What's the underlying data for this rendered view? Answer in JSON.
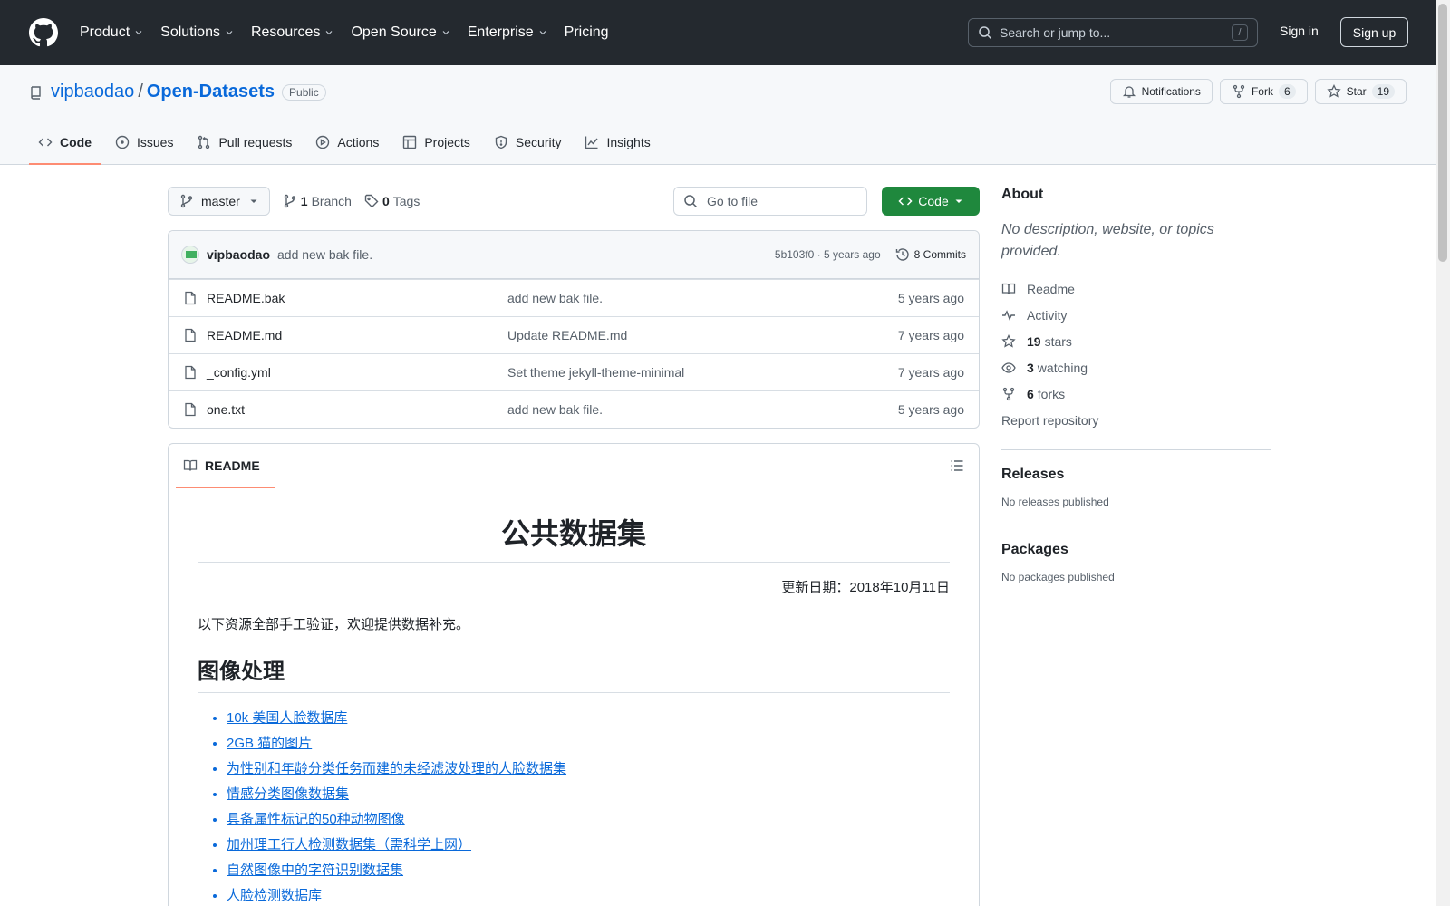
{
  "header": {
    "nav": [
      "Product",
      "Solutions",
      "Resources",
      "Open Source",
      "Enterprise",
      "Pricing"
    ],
    "search_placeholder": "Search or jump to...",
    "search_shortcut": "/",
    "sign_in": "Sign in",
    "sign_up": "Sign up"
  },
  "repo": {
    "owner": "vipbaodao",
    "separator": "/",
    "name": "Open-Datasets",
    "visibility": "Public",
    "notifications_label": "Notifications",
    "fork_label": "Fork",
    "fork_count": "6",
    "star_label": "Star",
    "star_count": "19",
    "tabs": [
      "Code",
      "Issues",
      "Pull requests",
      "Actions",
      "Projects",
      "Security",
      "Insights"
    ]
  },
  "toolbar": {
    "branch": "master",
    "branch_count": "1",
    "branch_label": "Branch",
    "tag_count": "0",
    "tag_label": "Tags",
    "go_to_file": "Go to file",
    "code_button": "Code"
  },
  "latest_commit": {
    "author": "vipbaodao",
    "message": "add new bak file.",
    "meta": "5b103f0 · 5 years ago",
    "commits": "8 Commits"
  },
  "files": [
    {
      "name": "README.bak",
      "message": "add new bak file.",
      "time": "5 years ago"
    },
    {
      "name": "README.md",
      "message": "Update README.md",
      "time": "7 years ago"
    },
    {
      "name": "_config.yml",
      "message": "Set theme jekyll-theme-minimal",
      "time": "7 years ago"
    },
    {
      "name": "one.txt",
      "message": "add new bak file.",
      "time": "5 years ago"
    }
  ],
  "readme": {
    "tab": "README",
    "title": "公共数据集",
    "date": "更新日期：2018年10月11日",
    "intro": "以下资源全部手工验证，欢迎提供数据补充。",
    "section": "图像处理",
    "links": [
      "10k 美国人脸数据库",
      "2GB 猫的图片",
      "为性别和年龄分类任务而建的未经滤波处理的人脸数据集",
      "情感分类图像数据集",
      "具备属性标记的50种动物图像",
      "加州理工行人检测数据集（需科学上网）",
      "自然图像中的字符识别数据集",
      "人脸检测数据库"
    ]
  },
  "sidebar": {
    "about_title": "About",
    "description": "No description, website, or topics provided.",
    "readme": "Readme",
    "activity": "Activity",
    "stars_count": "19",
    "stars_label": "stars",
    "watching_count": "3",
    "watching_label": "watching",
    "forks_count": "6",
    "forks_label": "forks",
    "report": "Report repository",
    "releases_title": "Releases",
    "releases_text": "No releases published",
    "packages_title": "Packages",
    "packages_text": "No packages published"
  }
}
